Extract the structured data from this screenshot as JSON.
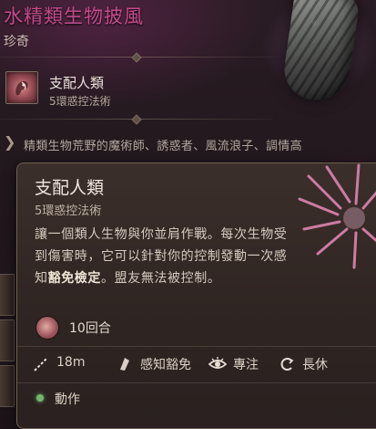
{
  "item": {
    "name": "水精類生物披風",
    "rarity": "珍奇",
    "icon": "cloak-image"
  },
  "granted_spell": {
    "name": "支配人類",
    "level": "5環惑控法術",
    "icon": "dominate-person-icon"
  },
  "lore": {
    "icon": "chevron-right-icon",
    "text": "精類生物荒野的魔術師、誘惑者、風流浪子、調情高"
  },
  "tooltip": {
    "title": "支配人類",
    "level": "5環惑控法術",
    "description_parts": {
      "part1": "讓一個類人生物與你並肩作戰。每次生物受到傷害時，它可以針對你的控制發動一次感知",
      "keyword": "豁免檢定",
      "part2": "。盟友無法被控制。"
    },
    "duration": "10回合",
    "properties": {
      "range": {
        "label": "18m",
        "icon": "range-icon"
      },
      "save": {
        "label": "感知豁免",
        "icon": "saving-throw-icon"
      },
      "concentration": {
        "label": "專注",
        "icon": "concentration-eye-icon"
      },
      "recharge": {
        "label": "長休",
        "icon": "long-rest-icon"
      }
    },
    "cost": {
      "label": "動作",
      "icon": "action-dot-icon",
      "color": "#6fb66c"
    }
  },
  "colors": {
    "rarity_title": "#c54a8e",
    "panel_bg": "#2f2522",
    "panel_border": "#6f6055"
  }
}
